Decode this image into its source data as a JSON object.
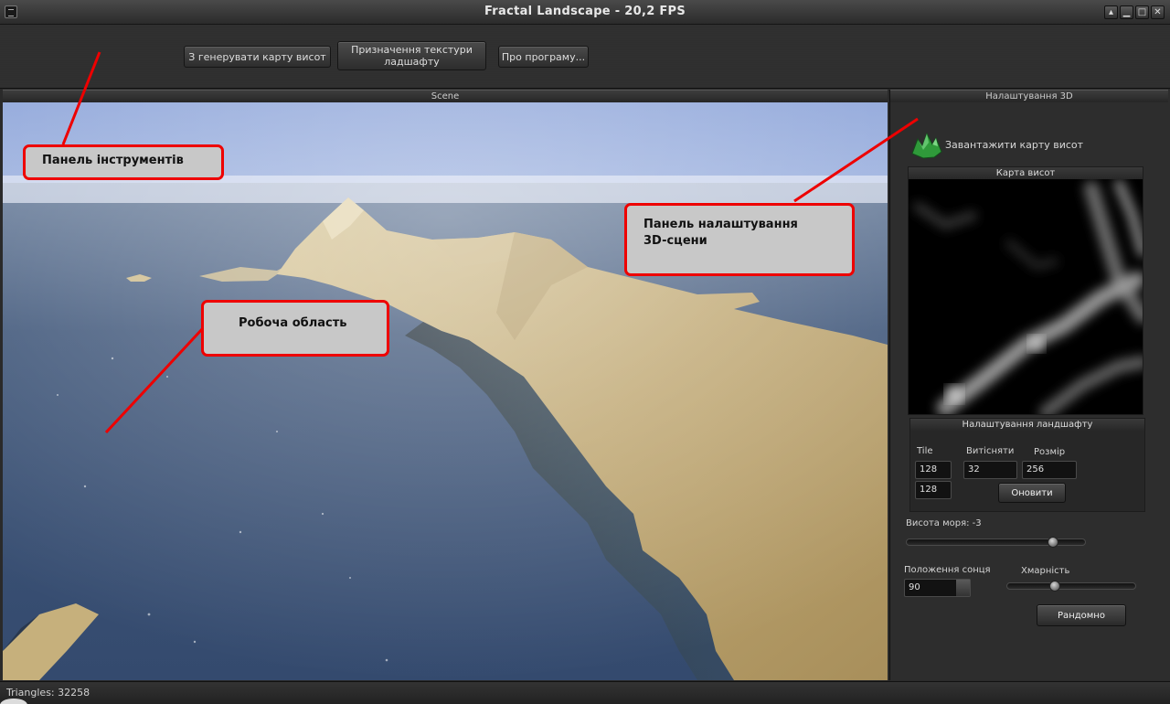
{
  "window": {
    "title": "Fractal Landscape - 20,2 FPS"
  },
  "toolbar": {
    "generate_label": "З генерувати карту висот",
    "texture_label_line1": "Призначення текстури",
    "texture_label_line2": "ладшафту",
    "about_label": "Про програму..."
  },
  "scene": {
    "header": "Scene"
  },
  "panel": {
    "header": "Налаштування 3D",
    "load_label": "Завантажити  карту висот",
    "heightmap_title": "Карта висот",
    "landscape_title": "Налаштування ландшафту",
    "tile_label": "Tile",
    "displace_label": "Витісняти",
    "size_label": "Розмір",
    "tile_x": "128",
    "tile_y": "128",
    "displace_value": "32",
    "size_value": "256",
    "update_label": "Оновити",
    "sea_label": "Висота моря: -3",
    "sea_level": -3,
    "sun_label": "Положення сонця",
    "sun_value": "90",
    "clouds_label": "Хмарність",
    "random_label": "Рандомно"
  },
  "annotations": {
    "toolbar_panel": "Панель інструментів",
    "work_area": "Робоча область",
    "settings_panel_line1": "Панель налаштування",
    "settings_panel_line2": "3D-сцени",
    "color": "#e00000"
  },
  "status": {
    "triangles": "Triangles: 32258"
  }
}
